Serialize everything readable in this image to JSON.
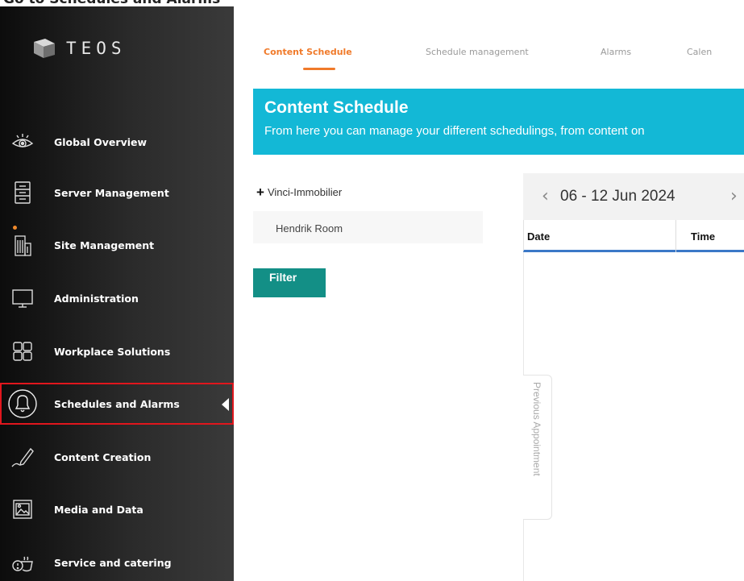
{
  "top_cutoff_text": "Go to Schedules and Alarms",
  "sidebar": {
    "logo_text": "TEOS",
    "items": [
      {
        "label": "Global Overview",
        "icon": "eye-icon"
      },
      {
        "label": "Server Management",
        "icon": "server-icon"
      },
      {
        "label": "Site Management",
        "icon": "building-icon"
      },
      {
        "label": "Administration",
        "icon": "monitor-icon"
      },
      {
        "label": "Workplace Solutions",
        "icon": "grid-icon"
      },
      {
        "label": "Schedules and Alarms",
        "icon": "bell-icon",
        "active": true
      },
      {
        "label": "Content Creation",
        "icon": "pen-icon"
      },
      {
        "label": "Media and Data",
        "icon": "image-icon"
      },
      {
        "label": "Service and catering",
        "icon": "cup-icon"
      }
    ]
  },
  "tabs": [
    {
      "label": "Content Schedule",
      "active": true
    },
    {
      "label": "Schedule management",
      "active": false
    },
    {
      "label": "Alarms",
      "active": false
    },
    {
      "label": "Calen",
      "active": false
    }
  ],
  "banner": {
    "title": "Content Schedule",
    "subtitle": "From here you can manage your different schedulings, from content on"
  },
  "filters": {
    "company": "Vinci-Immobilier",
    "room": "Hendrik Room",
    "filter_button": "Filter"
  },
  "calendar": {
    "range": "06 - 12 Jun 2024",
    "columns": [
      "Date",
      "Time"
    ],
    "previous_appointment": "Previous Appointment"
  },
  "colors": {
    "accent_orange": "#f07a2a",
    "banner_cyan": "#13b8d6",
    "filter_teal": "#138f86",
    "active_border_red": "#e0161d",
    "header_line_blue": "#3b78c7"
  }
}
